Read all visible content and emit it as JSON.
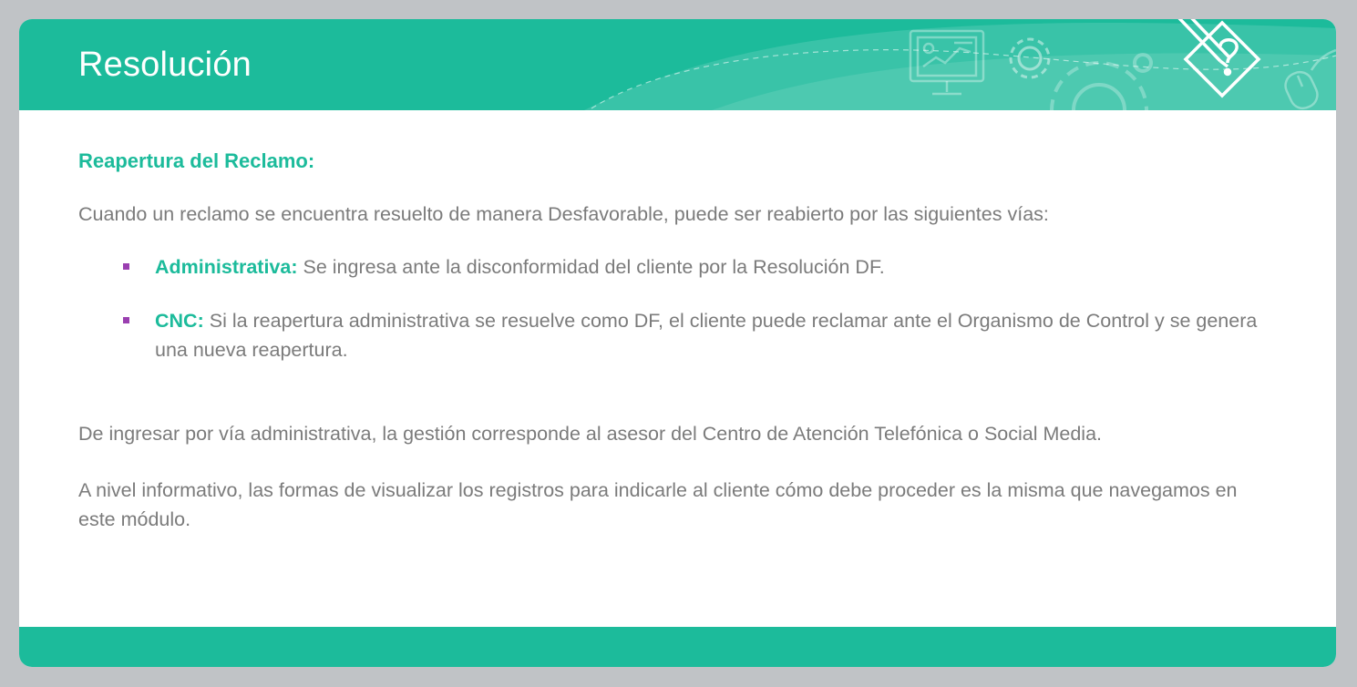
{
  "header": {
    "title": "Resolución",
    "illustration_icons": [
      "presentation-board-icon",
      "gear-icon",
      "large-gear-icon",
      "pencil-question-diamond-icon",
      "computer-mouse-icon"
    ]
  },
  "section": {
    "subtitle": "Reapertura del Reclamo:",
    "intro": "Cuando un reclamo se encuentra resuelto de manera Desfavorable, puede ser reabierto por las siguientes vías:",
    "bullets": [
      {
        "term": "Administrativa:",
        "text": " Se ingresa ante la disconformidad del cliente por la Resolución DF."
      },
      {
        "term": "CNC:",
        "text": " Si la reapertura administrativa se resuelve como DF, el cliente puede reclamar ante el Organismo de Control y se genera una nueva reapertura."
      }
    ],
    "paragraph_2": "De ingresar por vía administrativa, la gestión corresponde al asesor del Centro de Atención Telefónica o Social Media.",
    "paragraph_3": "A nivel informativo, las formas de visualizar los registros para indicarle al cliente cómo debe proceder es la misma que navegamos en este módulo."
  },
  "colors": {
    "accent": "#1cbb9b",
    "bullet_marker": "#9a3fb0",
    "body_text": "#7b7b7b",
    "background": "#c0c3c6"
  }
}
